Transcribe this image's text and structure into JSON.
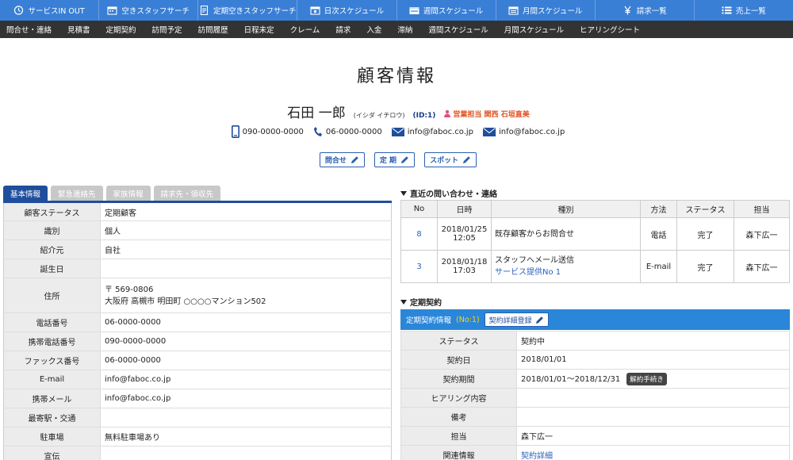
{
  "colors": {
    "topnav": "#3a7fd6",
    "subnav": "#333333",
    "tab_active": "#1f4e9c",
    "contract_bar": "#2a86d8",
    "staff_text": "#e05020"
  },
  "topnav": [
    {
      "label": "サービスIN OUT",
      "icon": "clock-icon"
    },
    {
      "label": "空きスタッフサーチ",
      "icon": "calendar-icon"
    },
    {
      "label": "定期空きスタッフサーチ",
      "icon": "document-icon"
    },
    {
      "label": "日次スケジュール",
      "icon": "calendar-icon"
    },
    {
      "label": "週間スケジュール",
      "icon": "week-calendar-icon"
    },
    {
      "label": "月間スケジュール",
      "icon": "calendar-icon"
    },
    {
      "label": "請求一覧",
      "icon": "yen-icon"
    },
    {
      "label": "売上一覧",
      "icon": "list-icon"
    }
  ],
  "subnav": [
    "問合せ・連絡",
    "見積書",
    "定期契約",
    "訪問予定",
    "訪問履歴",
    "日程未定",
    "クレーム",
    "請求",
    "入金",
    "滞納",
    "週間スケジュール",
    "月間スケジュール",
    "ヒアリングシート"
  ],
  "header": {
    "title": "顧客情報",
    "name": "石田 一郎",
    "kana": "(イシダ イチロウ)",
    "id": "(ID:1)",
    "staff": "営業担当 関西 石垣直美",
    "phone": "090-0000-0000",
    "tel": "06-0000-0000",
    "email1": "info@faboc.co.jp",
    "email2": "info@faboc.co.jp",
    "buttons": {
      "inquiry": "問合せ",
      "regular": "定 期",
      "spot": "スポット"
    }
  },
  "tabs": [
    "基本情報",
    "緊急連絡先",
    "家族情報",
    "請求先・領収先"
  ],
  "basic_info": [
    {
      "label": "顧客ステータス",
      "value": "定期顧客"
    },
    {
      "label": "識別",
      "value": "個人"
    },
    {
      "label": "紹介元",
      "value": "自社"
    },
    {
      "label": "誕生日",
      "value": ""
    },
    {
      "label": "住所",
      "value": "〒 569-0806",
      "value2": "大阪府 高槻市 明田町 ○○○○マンション502"
    },
    {
      "label": "電話番号",
      "value": "06-0000-0000"
    },
    {
      "label": "携帯電話番号",
      "value": "090-0000-0000"
    },
    {
      "label": "ファックス番号",
      "value": "06-0000-0000"
    },
    {
      "label": "E-mail",
      "value": "info@faboc.co.jp"
    },
    {
      "label": "携帯メール",
      "value": "info@faboc.co.jp"
    },
    {
      "label": "最寄駅・交通",
      "value": ""
    },
    {
      "label": "駐車場",
      "value": "無料駐車場あり"
    },
    {
      "label": "宣伝",
      "value": ""
    }
  ],
  "inquiries": {
    "heading": "直近の問い合わせ・連絡",
    "columns": [
      "No",
      "日時",
      "種別",
      "方法",
      "ステータス",
      "担当"
    ],
    "rows": [
      {
        "no": "8",
        "date": "2018/01/25",
        "time": "12:05",
        "kind": "既存顧客からお問合せ",
        "kind_link": "",
        "method": "電話",
        "status": "完了",
        "staff": "森下広一"
      },
      {
        "no": "3",
        "date": "2018/01/18",
        "time": "17:03",
        "kind": "スタッフへメール送信",
        "kind_link": "サービス提供No 1",
        "method": "E-mail",
        "status": "完了",
        "staff": "森下広一"
      }
    ]
  },
  "contract": {
    "heading": "定期契約",
    "bar_label": "定期契約情報",
    "bar_no": "(No:1)",
    "register_button": "契約詳細登録",
    "cancel_button": "解約手続き",
    "rows": [
      {
        "label": "ステータス",
        "value": "契約中"
      },
      {
        "label": "契約日",
        "value": "2018/01/01"
      },
      {
        "label": "契約期間",
        "value": "2018/01/01～2018/12/31"
      },
      {
        "label": "ヒアリング内容",
        "value": ""
      },
      {
        "label": "備考",
        "value": ""
      },
      {
        "label": "担当",
        "value": "森下広一"
      },
      {
        "label": "関連情報",
        "value": "契約詳細"
      }
    ]
  }
}
